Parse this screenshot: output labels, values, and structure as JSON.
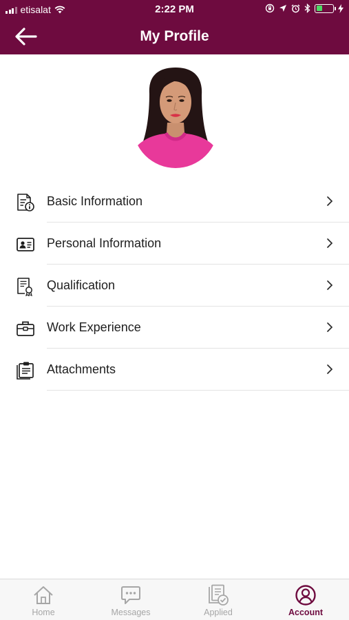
{
  "status_bar": {
    "carrier": "etisalat",
    "time": "2:22 PM",
    "battery_color": "#4cd964"
  },
  "header": {
    "title": "My Profile",
    "back_icon": "arrow-left-icon",
    "background": "#6e0b3f"
  },
  "profile": {
    "avatar": "profile-photo"
  },
  "menu": {
    "items": [
      {
        "label": "Basic Information",
        "icon": "document-info-icon"
      },
      {
        "label": "Personal Information",
        "icon": "id-card-icon"
      },
      {
        "label": "Qualification",
        "icon": "certificate-icon"
      },
      {
        "label": "Work Experience",
        "icon": "briefcase-icon"
      },
      {
        "label": "Attachments",
        "icon": "clipboard-icon"
      }
    ]
  },
  "tab_bar": {
    "active_color": "#6e0b3f",
    "inactive_color": "#a6a6a6",
    "tabs": [
      {
        "label": "Home",
        "icon": "home-icon",
        "active": false
      },
      {
        "label": "Messages",
        "icon": "chat-icon",
        "active": false
      },
      {
        "label": "Applied",
        "icon": "applied-documents-icon",
        "active": false
      },
      {
        "label": "Account",
        "icon": "user-circle-icon",
        "active": true
      }
    ]
  }
}
